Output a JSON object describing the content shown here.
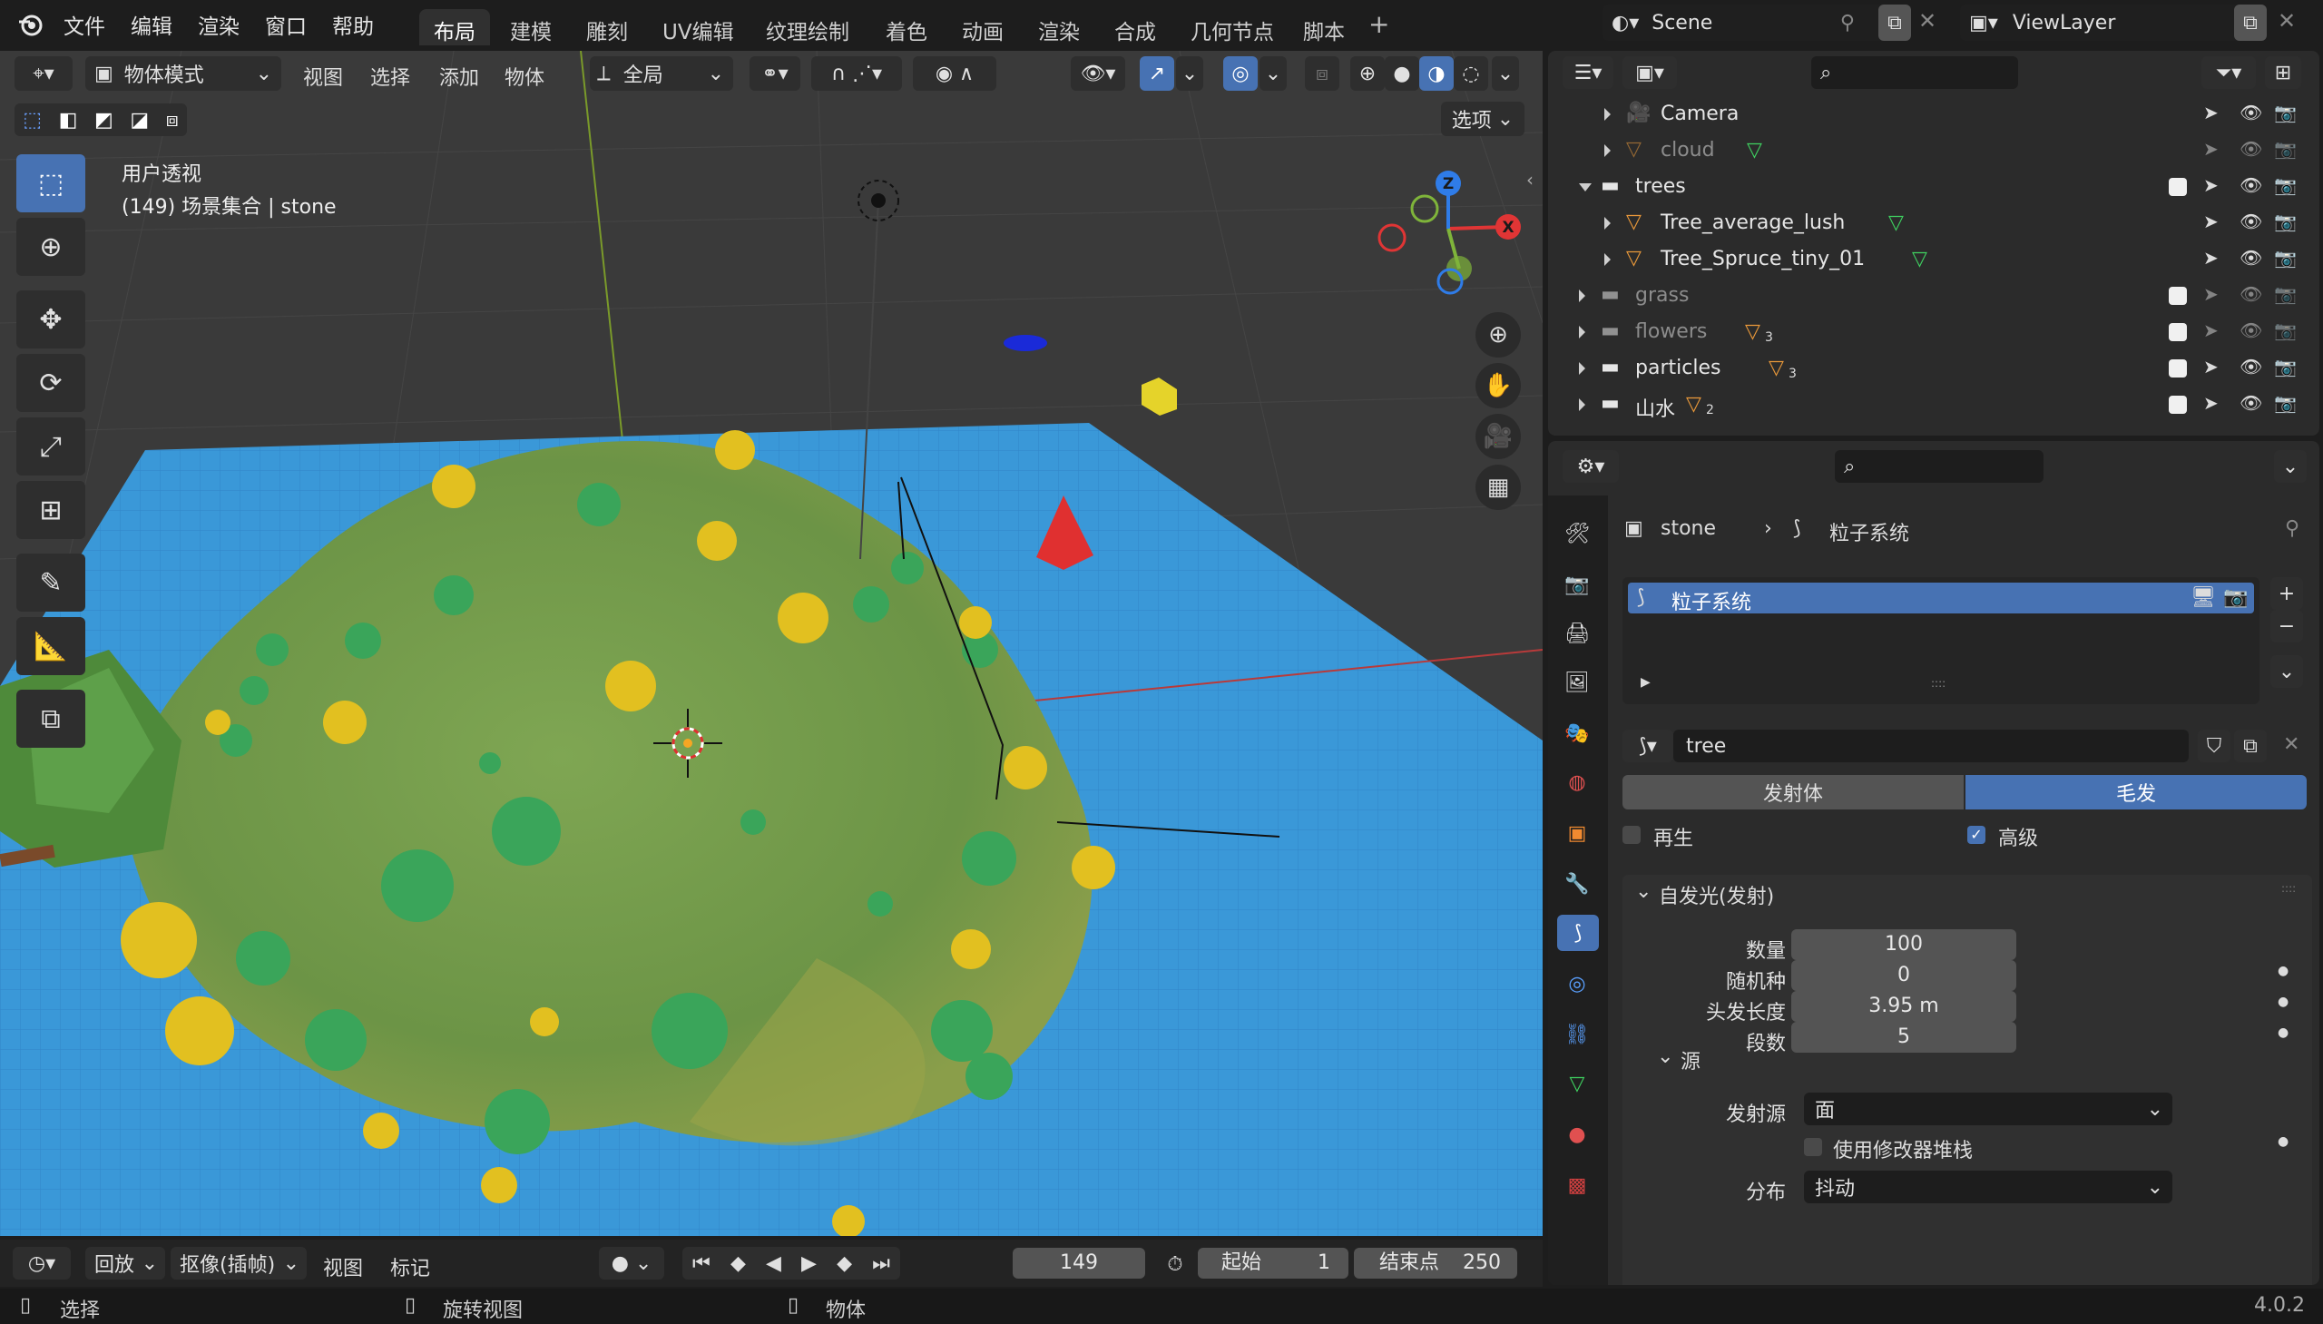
{
  "menu": {
    "file": "文件",
    "edit": "编辑",
    "render": "渲染",
    "window": "窗口",
    "help": "帮助"
  },
  "workspaces": [
    "布局",
    "建模",
    "雕刻",
    "UV编辑",
    "纹理绘制",
    "着色",
    "动画",
    "渲染",
    "合成",
    "几何节点",
    "脚本"
  ],
  "active_workspace": "布局",
  "scene": {
    "name": "Scene",
    "view_layer": "ViewLayer"
  },
  "viewport": {
    "mode": "物体模式",
    "menus": [
      "视图",
      "选择",
      "添加",
      "物体"
    ],
    "transform_orientation": "全局",
    "options_label": "选项",
    "view_name": "用户透视",
    "view_info": "(149) 场景集合 | stone",
    "gizmo": {
      "x": "X",
      "y": "Y",
      "z": "Z"
    }
  },
  "outliner": {
    "rows": [
      {
        "name": "Camera",
        "level": 2,
        "type": "camera",
        "dim": false
      },
      {
        "name": "cloud",
        "level": 2,
        "type": "mesh",
        "dim": true
      },
      {
        "name": "trees",
        "level": 1,
        "type": "collection",
        "dim": false,
        "expanded": true
      },
      {
        "name": "Tree_average_lush",
        "level": 2,
        "type": "mesh",
        "dim": false
      },
      {
        "name": "Tree_Spruce_tiny_01",
        "level": 2,
        "type": "mesh",
        "dim": false
      },
      {
        "name": "grass",
        "level": 1,
        "type": "collection",
        "dim": true
      },
      {
        "name": "flowers",
        "level": 1,
        "type": "collection",
        "dim": true,
        "count": "3"
      },
      {
        "name": "particles",
        "level": 1,
        "type": "collection",
        "dim": false,
        "count": "3"
      },
      {
        "name": "山水",
        "level": 1,
        "type": "collection",
        "dim": false,
        "count": "2"
      }
    ]
  },
  "properties": {
    "breadcrumb_object": "stone",
    "breadcrumb_section": "粒子系统",
    "particle_system_item": "粒子系统",
    "settings_name": "tree",
    "type_tabs": [
      "发射体",
      "毛发"
    ],
    "active_type": "毛发",
    "regrow_label": "再生",
    "advanced_label": "高级",
    "emission_panel": "自发光(发射)",
    "fields": [
      {
        "label": "数量",
        "value": "100"
      },
      {
        "label": "随机种",
        "value": "0"
      },
      {
        "label": "头发长度",
        "value": "3.95 m"
      },
      {
        "label": "段数",
        "value": "5"
      }
    ],
    "source_panel": "源",
    "emit_from_label": "发射源",
    "emit_from_value": "面",
    "use_modifier_stack_label": "使用修改器堆栈",
    "distribution_label": "分布",
    "distribution_value": "抖动"
  },
  "timeline": {
    "playback": "回放",
    "keying": "抠像(插帧)",
    "view": "视图",
    "marker": "标记",
    "current_frame": "149",
    "start_label": "起始",
    "start_value": "1",
    "end_label": "结束点",
    "end_value": "250"
  },
  "statusbar": {
    "select": "选择",
    "rotate_view": "旋转视图",
    "object": "物体",
    "version": "4.0.2"
  },
  "colors": {
    "accent_blue": "#4772b3",
    "ground_blue": "#3a98d8",
    "hill_green": "#6f9a4a",
    "tree_green": "#3aa55a",
    "tree_yellow": "#e2c020"
  }
}
